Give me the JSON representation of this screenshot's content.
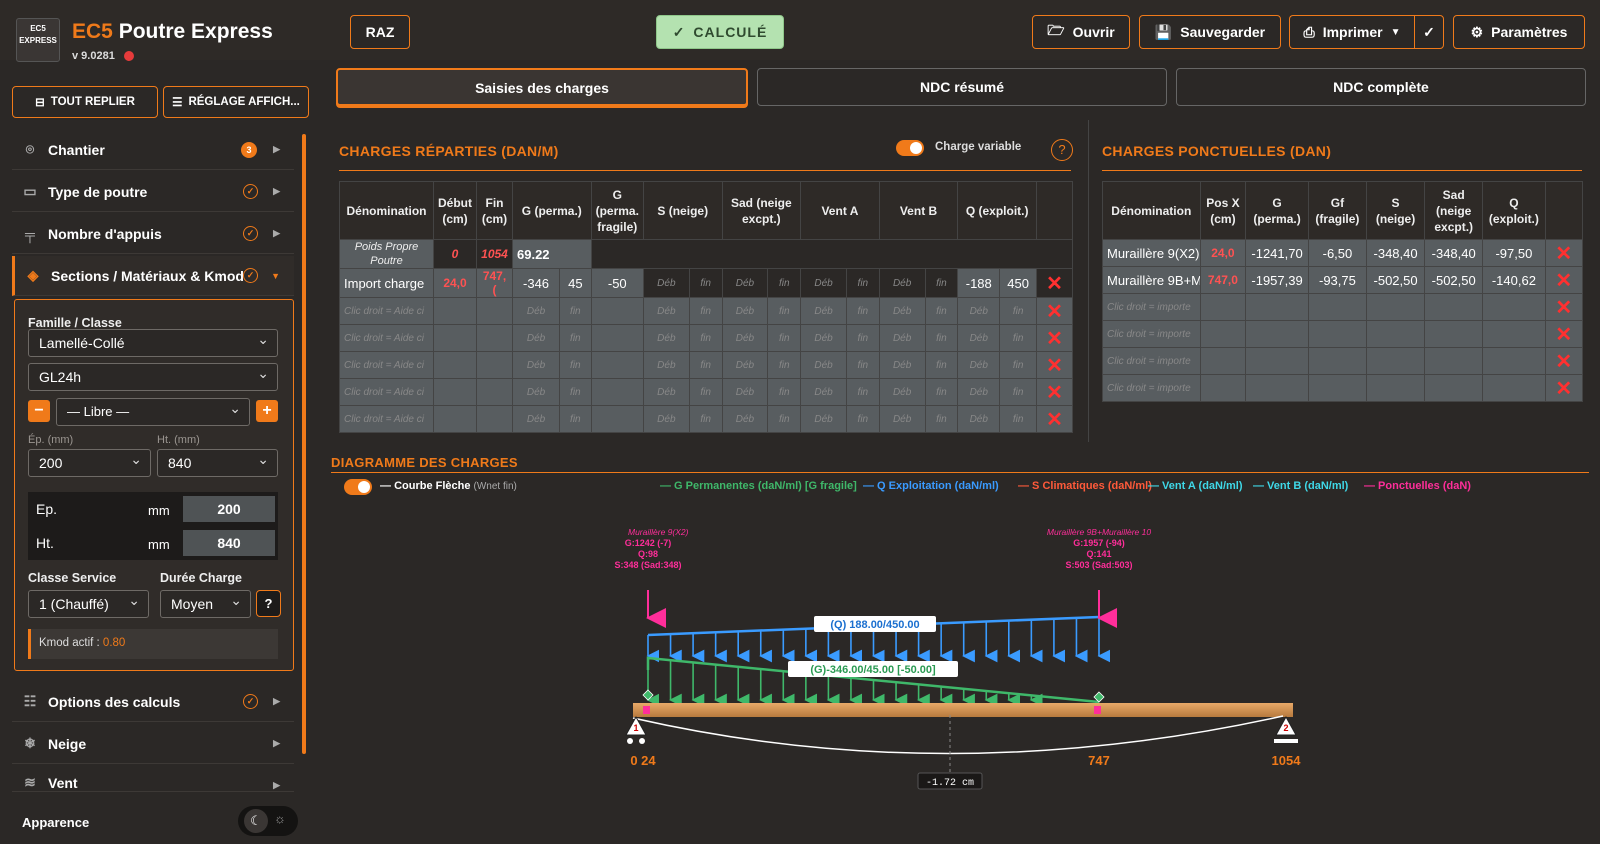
{
  "header": {
    "logo_text": "EC5 EXPRESS",
    "title_prefix": "EC5",
    "title_rest": "Poutre Express",
    "version": "v 9.0281",
    "raz": "RAZ",
    "calc": "CALCULÉ",
    "open": "Ouvrir",
    "save": "Sauvegarder",
    "print": "Imprimer",
    "settings": "Paramètres"
  },
  "sidebar": {
    "collapse_all": "TOUT REPLIER",
    "display_settings": "RÉGLAGE AFFICH...",
    "items": [
      {
        "label": "Chantier",
        "badge": "3"
      },
      {
        "label": "Type de poutre"
      },
      {
        "label": "Nombre d'appuis"
      },
      {
        "label": "Sections / Matériaux & Kmod"
      },
      {
        "label": "Options des calculs"
      },
      {
        "label": "Neige"
      },
      {
        "label": "Vent"
      }
    ],
    "panel": {
      "family_label": "Famille / Classe",
      "family": "Lamellé-Collé",
      "grade": "GL24h",
      "libre": "— Libre —",
      "ep_label": "Ép. (mm)",
      "ht_label": "Ht. (mm)",
      "ep_sel": "200",
      "ht_sel": "840",
      "ep_name": "Ep.",
      "ht_name": "Ht.",
      "unit": "mm",
      "ep_val": "200",
      "ht_val": "840",
      "service_label": "Classe Service",
      "duration_label": "Durée Charge",
      "service": "1 (Chauffé)",
      "duration": "Moyen",
      "help": "?",
      "kmod_label": "Kmod actif :",
      "kmod_val": "0.80"
    },
    "appearance": "Apparence"
  },
  "tabs": [
    "Saisies des charges",
    "NDC résumé",
    "NDC complète"
  ],
  "distributed": {
    "title": "CHARGES RÉPARTIES (DAN/M)",
    "variable_label": "Charge variable",
    "help": "?",
    "headers": [
      "Dénomination",
      "Début (cm)",
      "Fin (cm)",
      "G (perma.)",
      "G (perma. fragile)",
      "S (neige)",
      "Sad (neige excpt.)",
      "Vent A",
      "Vent B",
      "Q (exploit.)"
    ],
    "own_weight": {
      "name": "Poids Propre Poutre",
      "start": "0",
      "end": "1054",
      "g": "69.22"
    },
    "import_row": {
      "name": "Import charge",
      "start": "24,0",
      "end": "747,(",
      "g1": "-346",
      "g2": "45",
      "gf": "-50",
      "q1": "-188",
      "q2": "450"
    },
    "placeholder": "Clic droit = Aide ci",
    "deb": "Déb",
    "fin": "fin",
    "empty_rows": 5
  },
  "point": {
    "title": "CHARGES PONCTUELLES (DAN)",
    "headers": [
      "Dénomination",
      "Pos X (cm)",
      "G (perma.)",
      "Gf (fragile)",
      "S (neige)",
      "Sad (neige excpt.)",
      "Q (exploit.)"
    ],
    "rows": [
      [
        "Muraillère 9(X2)",
        "24,0",
        "-1241,70",
        "-6,50",
        "-348,40",
        "-348,40",
        "-97,50"
      ],
      [
        "Muraillère 9B+M",
        "747,0",
        "-1957,39",
        "-93,75",
        "-502,50",
        "-502,50",
        "-140,62"
      ]
    ],
    "placeholder": "Clic droit = importe"
  },
  "diagram": {
    "title": "DIAGRAMME DES CHARGES",
    "curve_label": "Courbe Flèche",
    "curve_sub": "(Wnet fin)",
    "legend": [
      {
        "text": "— G Permanentes (daN/ml) [G fragile]",
        "color": "#3fb86a"
      },
      {
        "text": "— Q Exploitation (daN/ml)",
        "color": "#3a9bff"
      },
      {
        "text": "— S Climatiques (daN/ml)",
        "color": "#ff5a3a"
      },
      {
        "text": "— Vent A (daN/ml)",
        "color": "#3fd8e8"
      },
      {
        "text": "— Vent B (daN/ml)",
        "color": "#3fd8e8"
      },
      {
        "text": "— Ponctuelles (daN)",
        "color": "#ff2e9a"
      }
    ],
    "p1": {
      "name": "Muraillère 9(X2)",
      "g": "G:1242 (-7)",
      "q": "Q:98",
      "s": "S:348 (Sad:348)"
    },
    "p2": {
      "name": "Muraillère 9B+Muraillère 10",
      "g": "G:1957 (-94)",
      "q": "Q:141",
      "s": "S:503 (Sad:503)"
    },
    "q_label": "(Q) 188.00/450.00",
    "g_label": "(G)-346.00/45.00 [-50.00]",
    "x_left": "0 24",
    "x_mid": "747",
    "x_right": "1054",
    "support1": "1",
    "support2": "2",
    "deflection": "-1.72 cm"
  }
}
